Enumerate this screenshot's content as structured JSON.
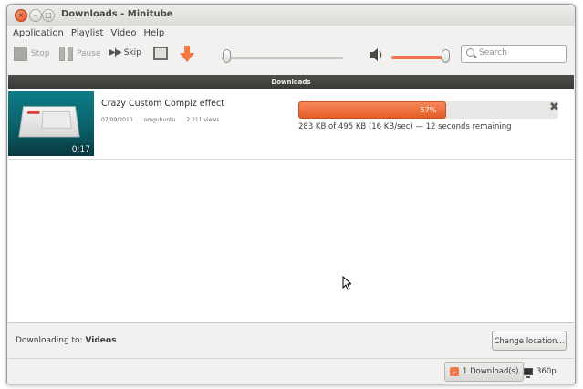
{
  "window": {
    "title": "Downloads - Minitube"
  },
  "menu": [
    "Application",
    "Playlist",
    "Video",
    "Help"
  ],
  "toolbar": {
    "stop_label": "Stop",
    "pause_label": "Pause",
    "skip_label": "Skip",
    "search_placeholder": "Search"
  },
  "downloads_header": "Downloads",
  "download": {
    "video_title": "Crazy Custom Compiz effect",
    "date": "07/09/2010",
    "author": "omgubuntu",
    "views": "2,211 views",
    "duration": "0:17",
    "progress_percent": 57,
    "progress_label": "57%",
    "status": "283 KB of 495 KB (16 KB/sec) — 12 seconds remaining"
  },
  "bottom": {
    "downloading_to_prefix": "Downloading to: ",
    "downloading_to_folder": "Videos",
    "change_location_label": "Change location..."
  },
  "statusbar": {
    "downloads_count_label": "1 Download(s)",
    "quality_label": "360p"
  },
  "colors": {
    "accent": "#f07746",
    "header_bg": "#3f3e3b"
  },
  "icons": [
    "close-icon",
    "minimize-icon",
    "maximize-icon",
    "stop-icon",
    "pause-icon",
    "skip-icon",
    "fullscreen-icon",
    "download-arrow-icon",
    "speaker-icon",
    "search-icon",
    "cancel-download-icon",
    "chevron-down-icon",
    "monitor-icon",
    "mouse-pointer-icon"
  ]
}
